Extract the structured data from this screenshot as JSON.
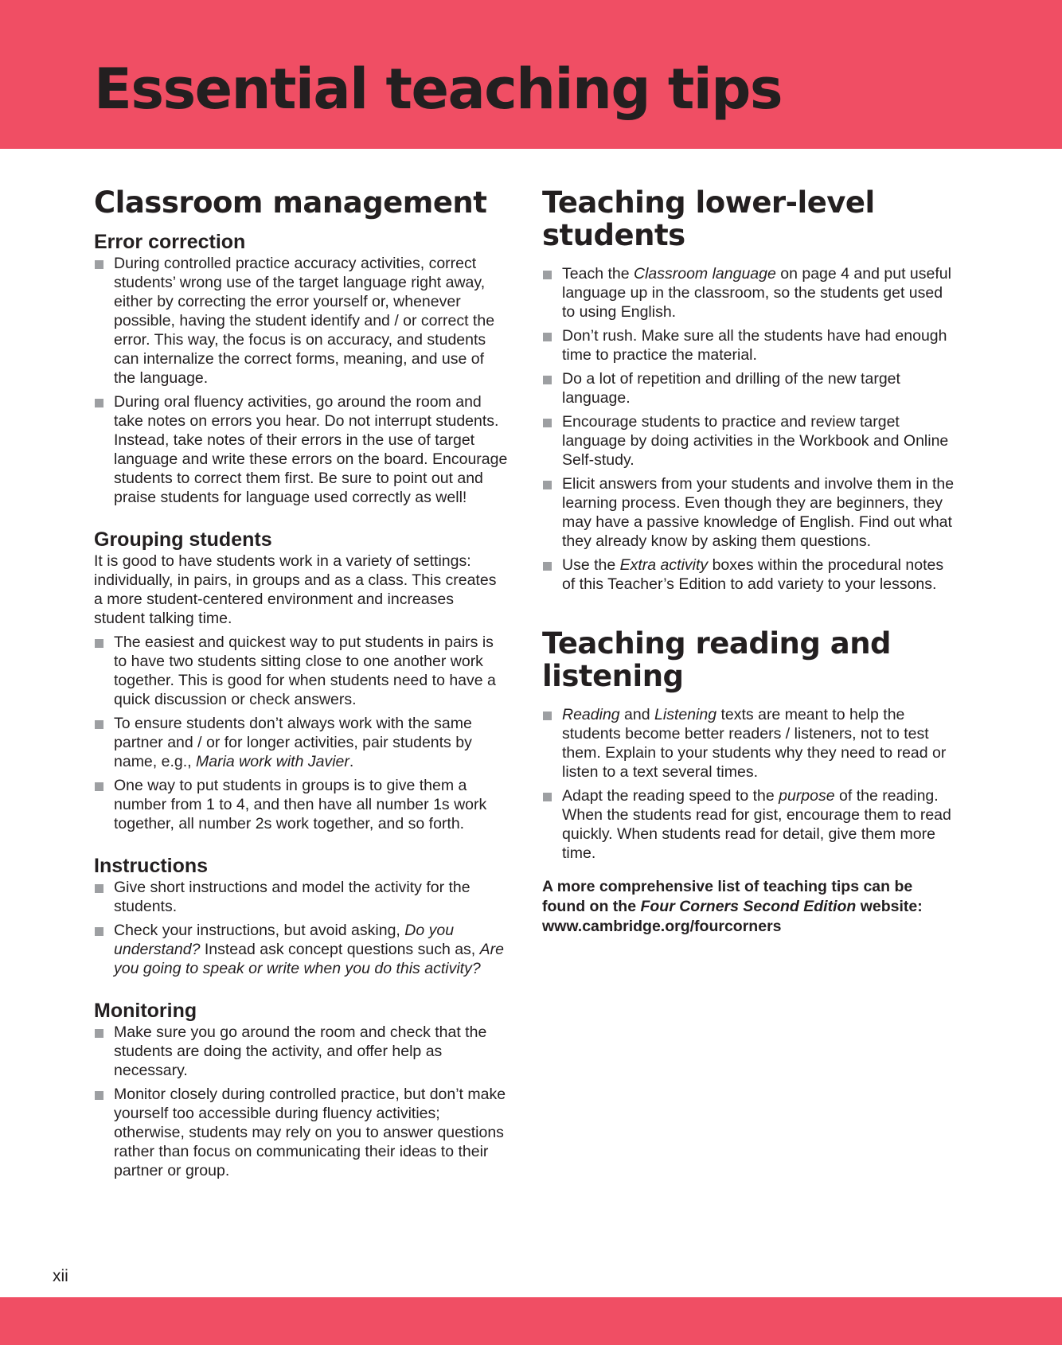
{
  "page": {
    "title": "Essential teaching tips",
    "page_number": "xii",
    "accent_color": "#f04e64",
    "bullet_color": "#9d9fa2"
  },
  "left": {
    "heading": "Classroom management",
    "error_correction": {
      "heading": "Error correction",
      "items": [
        "During controlled practice accuracy activities, correct students’ wrong use of the target language right away, either by correcting the error yourself or, whenever possible, having the student identify and / or correct the error. This way, the focus is on accuracy, and students can internalize the correct forms, meaning, and use of the language.",
        "During oral fluency activities, go around the room and take notes on errors you hear. Do not interrupt students. Instead, take notes of their errors in the use of target language and write these errors on the board. Encourage students to correct them first. Be sure to point out and praise students for language used correctly as well!"
      ]
    },
    "grouping": {
      "heading": "Grouping students",
      "intro": "It is good to have students work in a variety of settings: individually, in pairs, in groups and as a class. This creates a more student-centered environment and increases student talking time.",
      "item1": "The easiest and quickest way to put students in pairs is to have two students sitting close to one another work together. This is good for when students need to have a quick discussion or check answers.",
      "item2_a": "To ensure students don’t always work with the same partner and / or for longer activities, pair students by name, e.g., ",
      "item2_em": "Maria work with Javier",
      "item2_b": ".",
      "item3": "One way to put students in groups is to give them a number from 1 to 4, and then have all number 1s work together, all number 2s work together, and so forth."
    },
    "instructions": {
      "heading": "Instructions",
      "item1": "Give short instructions and model the activity for the students.",
      "item2_a": "Check your instructions, but avoid asking, ",
      "item2_em1": "Do you understand?",
      "item2_b": " Instead ask concept questions such as, ",
      "item2_em2": "Are you going to speak or write when you do this activity?"
    },
    "monitoring": {
      "heading": "Monitoring",
      "items": [
        "Make sure you go around the room and check that the students are doing the activity, and offer help as necessary.",
        "Monitor closely during controlled practice, but don’t make yourself too accessible during fluency activities; otherwise, students may rely on you to answer questions rather than focus on communicating their ideas to their partner or group."
      ]
    }
  },
  "right": {
    "lower_level": {
      "heading_line1": "Teaching lower-level",
      "heading_line2": "students",
      "item1_a": "Teach the ",
      "item1_em": "Classroom language",
      "item1_b": " on page 4 and put useful language up in the classroom, so the students get used to using English.",
      "item2": "Don’t rush. Make sure all the students have had enough time to practice the material.",
      "item3": "Do a lot of repetition and drilling of the new target language.",
      "item4": "Encourage students to practice and review target language by doing activities in the Workbook and Online Self-study.",
      "item5": "Elicit answers from your students and involve them in the learning process. Even though they are beginners, they may have a passive knowledge of English. Find out what they already know by asking them questions.",
      "item6_a": "Use the ",
      "item6_em": "Extra activity",
      "item6_b": " boxes within the procedural notes of this Teacher’s Edition to add variety to your lessons."
    },
    "reading_listening": {
      "heading_line1": "Teaching reading and",
      "heading_line2": "listening",
      "item1_em1": "Reading",
      "item1_a": " and ",
      "item1_em2": "Listening",
      "item1_b": " texts are meant to help the students become better readers / listeners, not to test them. Explain to your students why they need to read or listen to a text several times.",
      "item2_a": "Adapt the reading speed to the ",
      "item2_em": "purpose",
      "item2_b": " of the reading. When the students read for gist, encourage them to read quickly. When students read for detail, give them more time."
    },
    "note": {
      "text_a": "A more comprehensive list of teaching tips can be found on the ",
      "text_em": "Four Corners Second Edition",
      "text_b": " website: www.cambridge.org/fourcorners"
    }
  }
}
